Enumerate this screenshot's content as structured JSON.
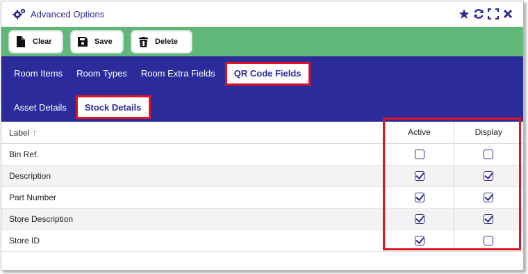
{
  "window": {
    "title": "Advanced Options",
    "icons": [
      "settings-gears-icon",
      "star-icon",
      "refresh-icon",
      "expand-icon",
      "close-icon"
    ]
  },
  "toolbar": {
    "clear_label": "Clear",
    "save_label": "Save",
    "delete_label": "Delete"
  },
  "tabs_row1": [
    {
      "label": "Room Items"
    },
    {
      "label": "Room Types"
    },
    {
      "label": "Room Extra Fields"
    },
    {
      "label": "QR Code Fields",
      "active": true
    }
  ],
  "tabs_row2": [
    {
      "label": "Asset Details"
    },
    {
      "label": "Stock Details",
      "active": true
    }
  ],
  "table": {
    "headers": {
      "label": "Label",
      "active": "Active",
      "display": "Display"
    },
    "rows": [
      {
        "label": "Bin Ref.",
        "active": false,
        "display": false
      },
      {
        "label": "Description",
        "active": true,
        "display": true
      },
      {
        "label": "Part Number",
        "active": true,
        "display": true
      },
      {
        "label": "Store Description",
        "active": true,
        "display": true
      },
      {
        "label": "Store ID",
        "active": true,
        "display": false
      }
    ]
  },
  "colors": {
    "accent": "#2b2b9c",
    "toolbar": "#5fb779",
    "highlight": "#e0141e"
  }
}
